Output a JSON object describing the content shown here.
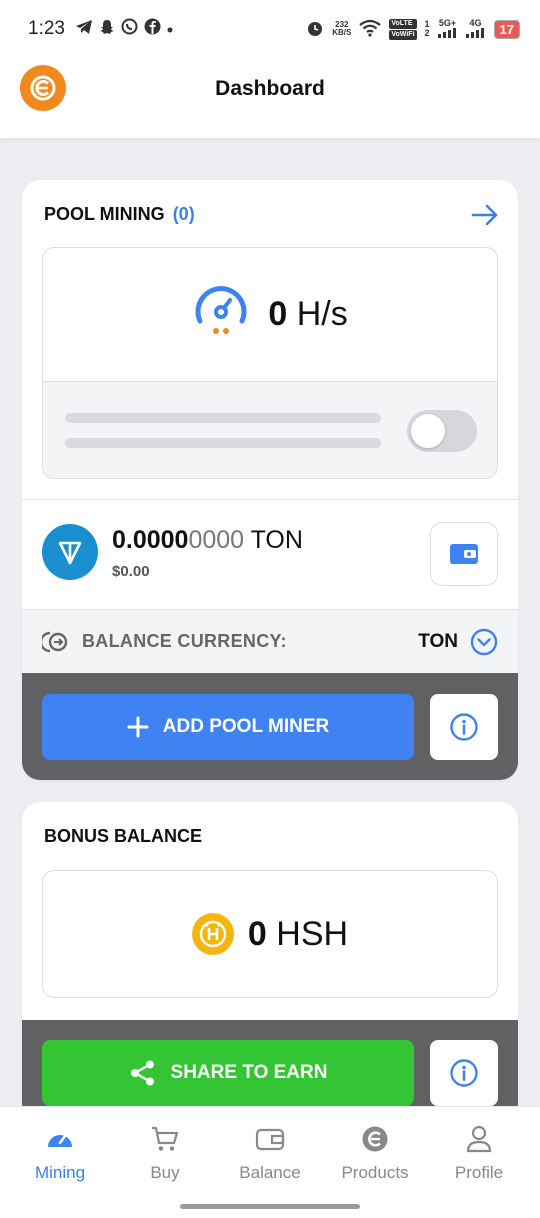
{
  "status_bar": {
    "time": "1:23",
    "net_speed_value": "232",
    "net_speed_unit": "KB/S",
    "volte_label": "VoLTE",
    "vowifi_label": "VoWiFi",
    "sim1": "1",
    "sim2": "2",
    "network_5g": "5G+",
    "network_4g": "4G",
    "battery": "17"
  },
  "header": {
    "title": "Dashboard"
  },
  "pool_mining": {
    "title": "POOL MINING",
    "count": "(0)",
    "hashrate_value": "0",
    "hashrate_unit": "H/s",
    "toggle_on": false,
    "ton_amount_main": "0.0000",
    "ton_amount_fraction": "0000",
    "ton_unit": "TON",
    "usd_value": "$0.00",
    "currency_label": "BALANCE CURRENCY:",
    "currency_value": "TON",
    "add_button_label": "ADD POOL MINER"
  },
  "bonus_balance": {
    "title": "BONUS BALANCE",
    "value": "0",
    "unit": "HSH",
    "share_button_label": "SHARE TO EARN"
  },
  "bottom_nav": {
    "items": [
      {
        "label": "Mining",
        "icon": "speedometer-icon",
        "active": true
      },
      {
        "label": "Buy",
        "icon": "cart-icon",
        "active": false
      },
      {
        "label": "Balance",
        "icon": "wallet-icon",
        "active": false
      },
      {
        "label": "Products",
        "icon": "products-logo-icon",
        "active": false
      },
      {
        "label": "Profile",
        "icon": "user-icon",
        "active": false
      }
    ]
  },
  "colors": {
    "accent_blue": "#3f82f2",
    "brand_orange": "#f08a1c",
    "share_green": "#34c534",
    "ton_blue": "#1a8fcf",
    "hsh_gold": "#f5b50f"
  }
}
